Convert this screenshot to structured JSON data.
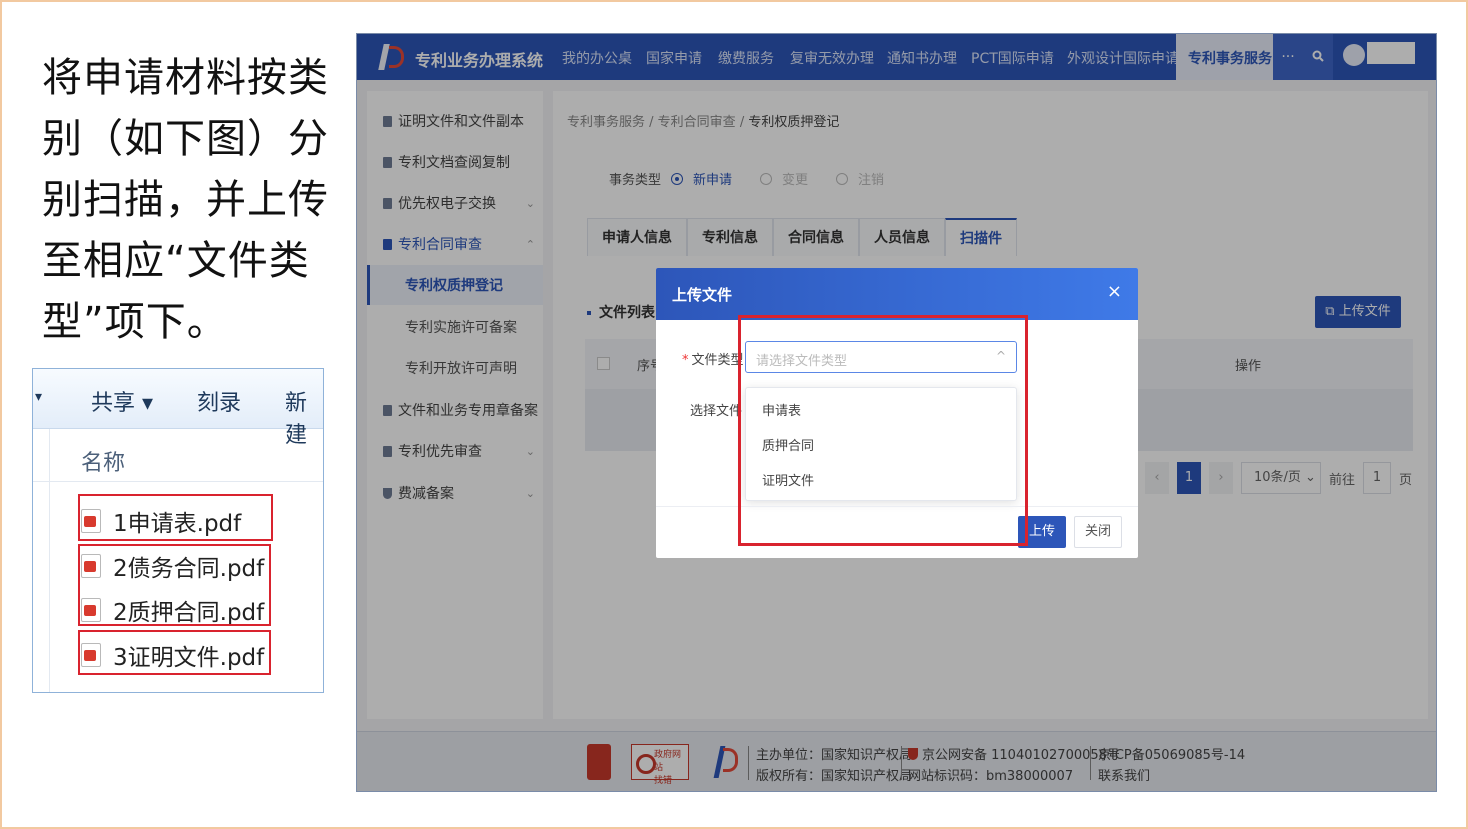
{
  "instruction": {
    "text": "将申请材料按类别（如下图）分别扫描，并上传至相应“文件类型”项下。"
  },
  "explorer": {
    "toolbar": {
      "share": "共享 ▾",
      "burn": "刻录",
      "new": "新建"
    },
    "column_name": "名称",
    "files": [
      "1申请表.pdf",
      "2债务合同.pdf",
      "2质押合同.pdf",
      "3证明文件.pdf"
    ]
  },
  "app": {
    "system_title": "专利业务办理系统",
    "nav": [
      "我的办公桌",
      "国家申请",
      "缴费服务",
      "复审无效办理",
      "通知书办理",
      "PCT国际申请",
      "外观设计国际申请",
      "专利事务服务"
    ],
    "nav_more": "···",
    "sidebar": [
      {
        "label": "证明文件和文件副本",
        "chevron": ""
      },
      {
        "label": "专利文档查阅复制",
        "chevron": ""
      },
      {
        "label": "优先权电子交换",
        "chevron": "⌄"
      },
      {
        "label": "专利合同审查",
        "chevron": "⌃"
      },
      {
        "label": "专利权质押登记",
        "chevron": ""
      },
      {
        "label": "专利实施许可备案",
        "chevron": ""
      },
      {
        "label": "专利开放许可声明",
        "chevron": ""
      },
      {
        "label": "文件和业务专用章备案",
        "chevron": "⌄"
      },
      {
        "label": "专利优先审查",
        "chevron": "⌄"
      },
      {
        "label": "费减备案",
        "chevron": "⌄"
      }
    ],
    "breadcrumb": {
      "l1": "专利事务服务",
      "sep": " / ",
      "l2": "专利合同审查",
      "l3": "专利权质押登记"
    },
    "matter_type": {
      "label": "事务类型",
      "options": [
        "新申请",
        "变更",
        "注销"
      ]
    },
    "tabs": [
      "申请人信息",
      "专利信息",
      "合同信息",
      "人员信息",
      "扫描件"
    ],
    "file_list_title": "文件列表",
    "upload_button": "⧉ 上传文件",
    "table_headers": {
      "seq": "序号",
      "op": "操作"
    },
    "pagination": {
      "prev": "‹",
      "page": "1",
      "next": "›",
      "size": "10条/页 ⌄",
      "goto": "前往",
      "goto_value": "1",
      "page_unit": "页"
    },
    "footer": {
      "gov_badge_line1": "政府网站",
      "gov_badge_line2": "找错",
      "host": "主办单位：国家知识产权局",
      "copyright": "版权所有：国家知识产权局",
      "police": "京公网安备 11040102700058号",
      "site_code": "网站标识码：bm38000007",
      "icp": "京ICP备05069085号-14",
      "contact": "联系我们"
    }
  },
  "dialog": {
    "title": "上传文件",
    "close": "×",
    "file_type_label": "文件类型",
    "file_type_placeholder": "请选择文件类型",
    "select_file_label": "选择文件",
    "options": [
      "申请表",
      "质押合同",
      "证明文件"
    ],
    "upload": "上传",
    "cancel": "关闭"
  },
  "colors": {
    "brand": "#2d56b9",
    "highlight": "#d9232e"
  }
}
